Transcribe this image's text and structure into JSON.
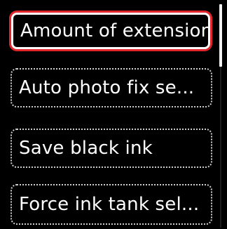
{
  "menu": {
    "items": [
      {
        "label": "Amount of extension",
        "selected": true
      },
      {
        "label": "Auto photo fix se...",
        "selected": false
      },
      {
        "label": "Save black ink",
        "selected": false
      },
      {
        "label": "Force ink tank sel...",
        "selected": false
      }
    ]
  },
  "scroll": {
    "position_fraction": 0.0,
    "visible_fraction": 0.28
  },
  "colors": {
    "background": "#000000",
    "text": "#ffffff",
    "item_border": "#cfcfcf",
    "selection_outline": "#e0262a"
  }
}
